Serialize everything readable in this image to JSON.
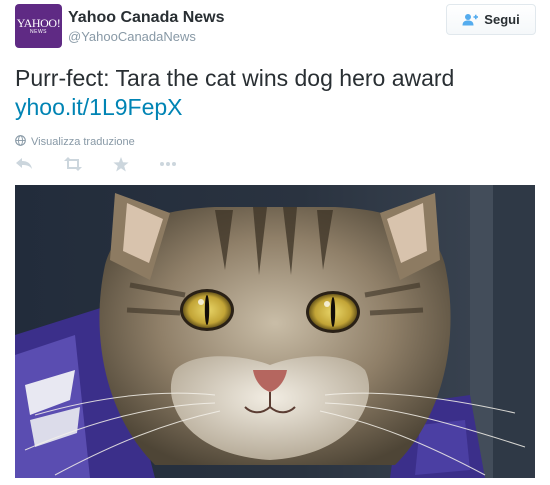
{
  "account": {
    "display_name": "Yahoo Canada News",
    "handle": "@YahooCanadaNews",
    "avatar_logo": "YAHOO!",
    "avatar_logo_sub": "NEWS"
  },
  "follow_button": {
    "label": "Segui",
    "icon": "add-user-icon"
  },
  "tweet": {
    "text": "Purr-fect: Tara the cat wins dog hero award",
    "link": "yhoo.it/1L9FepX"
  },
  "translate": {
    "label": "Visualizza traduzione",
    "icon": "globe-icon"
  },
  "actions": [
    "reply-icon",
    "retweet-icon",
    "favorite-icon",
    "more-icon"
  ],
  "media": {
    "subject": "tabby-cat-photo"
  },
  "colors": {
    "brand_purple": "#5f2a84",
    "link_blue": "#0084b4",
    "muted_gray": "#8899a6",
    "action_gray": "#ccd6dd",
    "text_dark": "#292f33"
  }
}
